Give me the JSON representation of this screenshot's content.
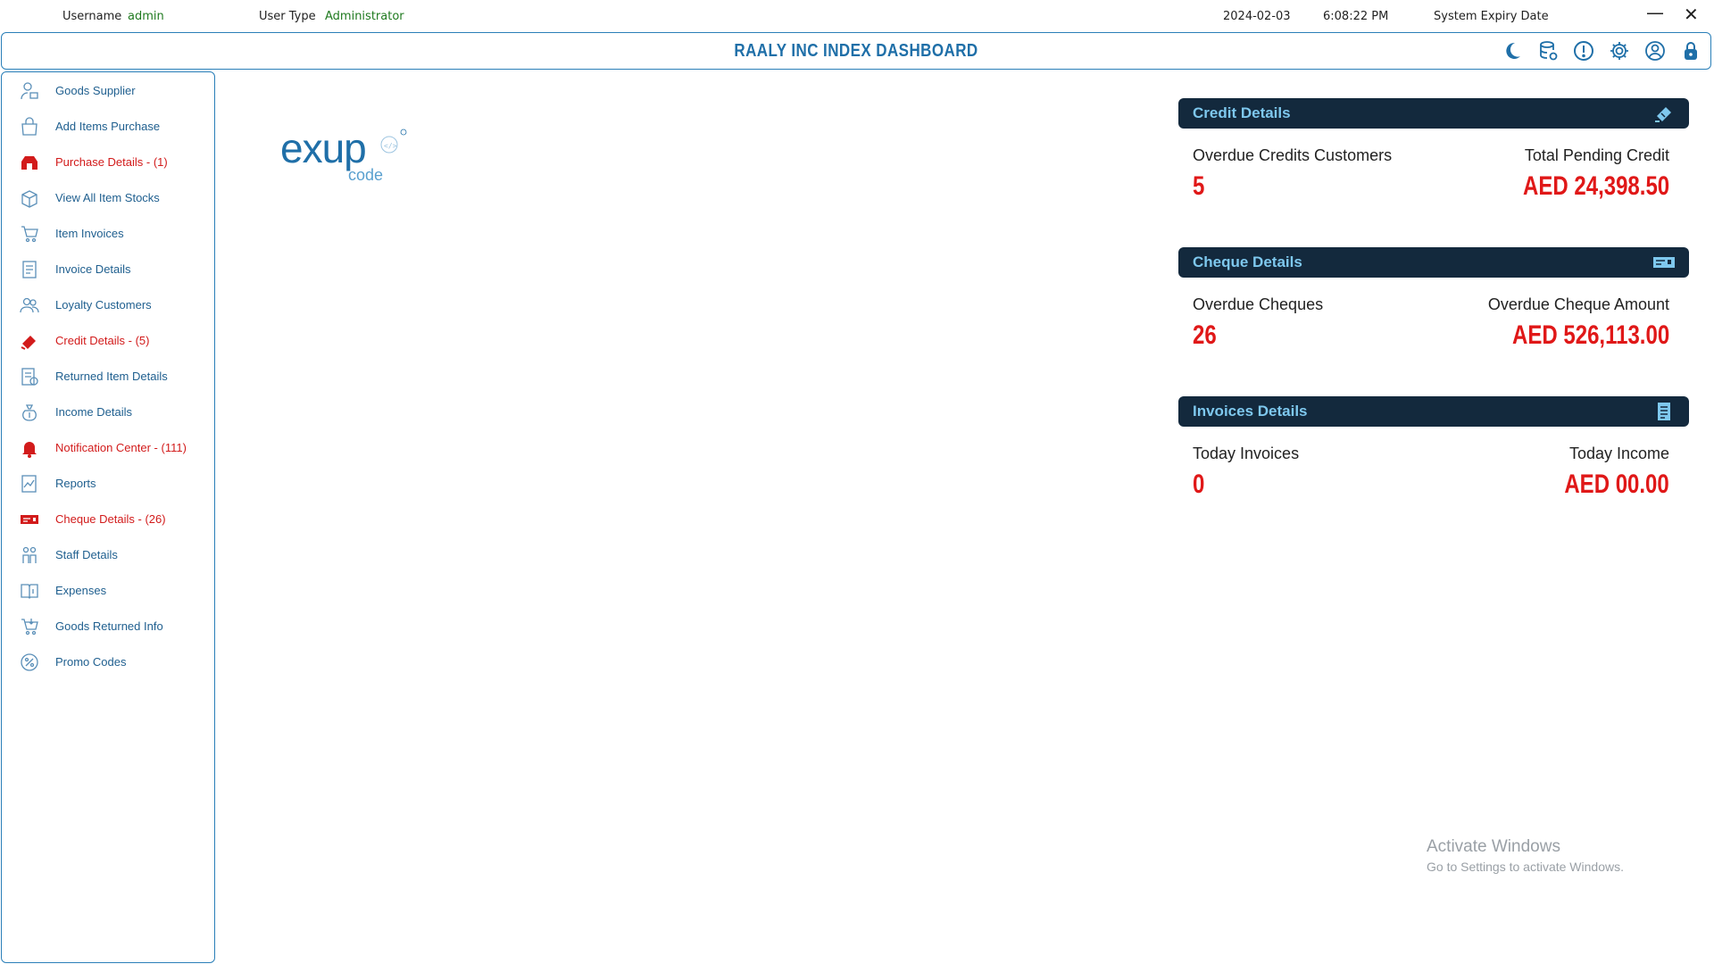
{
  "status": {
    "username_label": "Username",
    "username_value": "admin",
    "usertype_label": "User Type",
    "usertype_value": "Administrator",
    "date": "2024-02-03",
    "time": "6:08:22 PM",
    "expiry_label": "System Expiry Date",
    "minimize": "—",
    "close": "✕"
  },
  "header": {
    "title": "RAALY INC INDEX DASHBOARD",
    "icons": [
      "moon-icon",
      "database-icon",
      "alert-icon",
      "settings-icon",
      "user-icon",
      "lock-icon"
    ]
  },
  "sidebar": {
    "items": [
      {
        "label": "Goods Supplier",
        "icon": "supplier-icon",
        "alert": false
      },
      {
        "label": "Add Items Purchase",
        "icon": "shopping-bag-icon",
        "alert": false
      },
      {
        "label": "Purchase Details - (1)",
        "icon": "purchase-icon",
        "alert": true
      },
      {
        "label": "View All Item Stocks",
        "icon": "stock-box-icon",
        "alert": false
      },
      {
        "label": "Item Invoices",
        "icon": "cart-icon",
        "alert": false
      },
      {
        "label": "Invoice Details",
        "icon": "invoice-icon",
        "alert": false
      },
      {
        "label": "Loyalty Customers",
        "icon": "customers-icon",
        "alert": false
      },
      {
        "label": "Credit Details - (5)",
        "icon": "credit-icon",
        "alert": true
      },
      {
        "label": "Returned Item Details",
        "icon": "returned-item-icon",
        "alert": false
      },
      {
        "label": "Income Details",
        "icon": "money-bag-icon",
        "alert": false
      },
      {
        "label": "Notification Center - (111)",
        "icon": "bell-icon",
        "alert": true
      },
      {
        "label": "Reports",
        "icon": "reports-icon",
        "alert": false
      },
      {
        "label": "Cheque Details - (26)",
        "icon": "cheque-icon",
        "alert": true
      },
      {
        "label": "Staff Details",
        "icon": "staff-icon",
        "alert": false
      },
      {
        "label": "Expenses",
        "icon": "expenses-book-icon",
        "alert": false
      },
      {
        "label": "Goods Returned Info",
        "icon": "cart-return-icon",
        "alert": false
      },
      {
        "label": "Promo Codes",
        "icon": "percent-icon",
        "alert": false
      }
    ]
  },
  "logo": {
    "main": "exup",
    "sub": "code",
    "mark": "</>"
  },
  "cards": {
    "credit": {
      "title": "Credit Details",
      "icon": "credit-card-icon",
      "left_label": "Overdue Credits Customers",
      "left_value": "5",
      "right_label": "Total Pending Credit",
      "right_value": "AED 24,398.50"
    },
    "cheque": {
      "title": "Cheque Details",
      "icon": "cheque-card-icon",
      "left_label": "Overdue Cheques",
      "left_value": "26",
      "right_label": "Overdue Cheque Amount",
      "right_value": "AED 526,113.00"
    },
    "invoices": {
      "title": "Invoices Details",
      "icon": "document-icon",
      "left_label": "Today Invoices",
      "left_value": "0",
      "right_label": "Today Income",
      "right_value": "AED 00.00"
    }
  },
  "watermark": {
    "line1": "Activate Windows",
    "line2": "Go to Settings to activate Windows."
  },
  "colors": {
    "accent": "#1f6fa8",
    "card_header": "#13293d",
    "alert_red": "#e01818",
    "green": "#1f7a1f"
  }
}
